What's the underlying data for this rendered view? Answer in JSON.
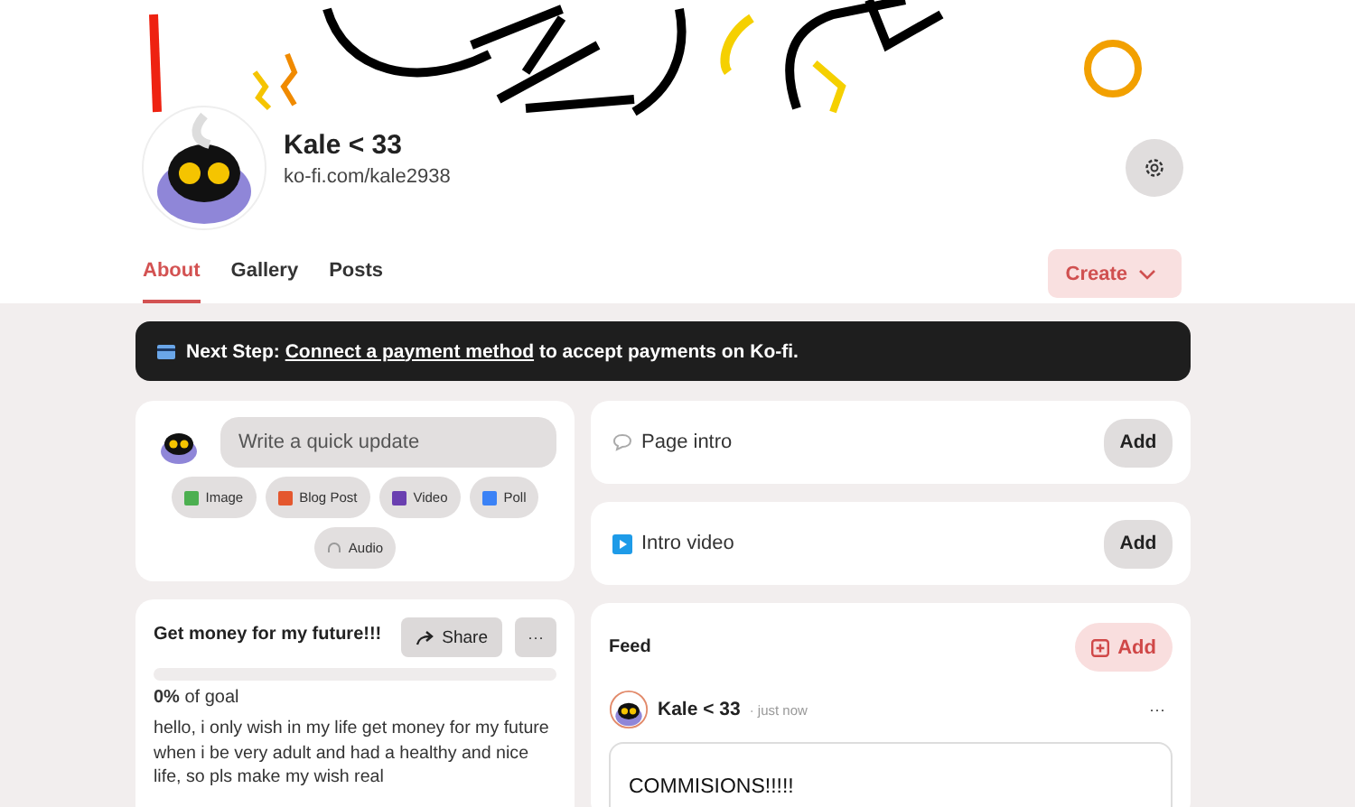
{
  "profile": {
    "name": "Kale < 33",
    "url": "ko-fi.com/kale2938"
  },
  "tabs": [
    {
      "label": "About",
      "selected": true
    },
    {
      "label": "Gallery",
      "selected": false
    },
    {
      "label": "Posts",
      "selected": false
    }
  ],
  "create_button": {
    "label": "Create"
  },
  "notice": {
    "lead": "Next Step:",
    "link": "Connect a payment method",
    "tail": "to accept payments on Ko-fi."
  },
  "composer": {
    "placeholder": "Write a quick update",
    "post_types": [
      {
        "kind": "image",
        "label": "Image"
      },
      {
        "kind": "blog",
        "label": "Blog Post"
      },
      {
        "kind": "video",
        "label": "Video"
      },
      {
        "kind": "poll",
        "label": "Poll"
      },
      {
        "kind": "audio",
        "label": "Audio"
      }
    ]
  },
  "sections": [
    {
      "kind": "intro",
      "label": "Page intro",
      "button": "Add"
    },
    {
      "kind": "video",
      "label": "Intro video",
      "button": "Add"
    }
  ],
  "goal": {
    "title": "Get money for my future!!!",
    "share": "Share",
    "more": "···",
    "progress": "**0%** of goal",
    "description": "hello, i only wish in my life get money for my future when i be very adult and had a healthy and nice life, so pls make my wish real"
  },
  "feed": {
    "title": "Feed",
    "add": "Add",
    "post": {
      "author": "Kale < 33",
      "time": "· just now",
      "more": "···",
      "content": "COMMISIONS!!!!!"
    }
  }
}
